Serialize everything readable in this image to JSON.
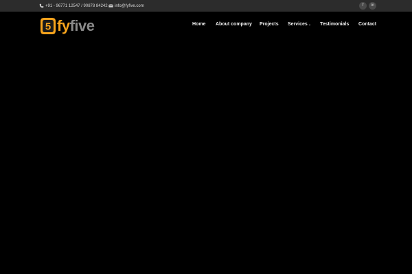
{
  "topbar": {
    "phone": "+91 - 96771 12547 / 90878 84242",
    "email": "info@fyfive.com",
    "social": [
      {
        "icon": "facebook-icon",
        "label": "f"
      },
      {
        "icon": "linkedin-icon",
        "label": "in"
      }
    ]
  },
  "logo": {
    "badge": "5",
    "text_fy": "fy",
    "text_five": "five"
  },
  "nav": {
    "items": [
      {
        "label": "Home"
      },
      {
        "label": "About company"
      },
      {
        "label": "Projects"
      },
      {
        "label": "Services"
      },
      {
        "label": "Testimonials"
      },
      {
        "label": "Contact"
      }
    ]
  },
  "colors": {
    "topbar_bg": "#2c2c2c",
    "page_bg": "#000000",
    "brand_orange": "#f7a41d",
    "brand_gray": "#8a8a8a"
  }
}
